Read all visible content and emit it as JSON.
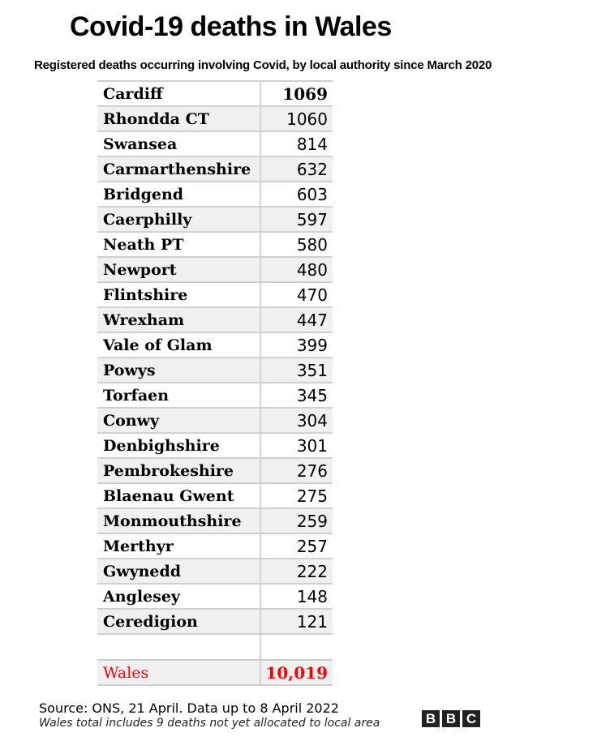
{
  "header": {
    "title": "Covid-19 deaths in Wales",
    "subtitle": "Registered deaths occurring involving Covid, by local authority since March 2020"
  },
  "chart_data": {
    "type": "table",
    "title": "Covid-19 deaths in Wales",
    "subtitle": "Registered deaths occurring involving Covid, by local authority since March 2020",
    "rows": [
      {
        "name": "Cardiff",
        "value": "1069"
      },
      {
        "name": "Rhondda CT",
        "value": "1060"
      },
      {
        "name": "Swansea",
        "value": "814"
      },
      {
        "name": "Carmarthenshire",
        "value": "632"
      },
      {
        "name": "Bridgend",
        "value": "603"
      },
      {
        "name": "Caerphilly",
        "value": "597"
      },
      {
        "name": "Neath PT",
        "value": "580"
      },
      {
        "name": "Newport",
        "value": "480"
      },
      {
        "name": "Flintshire",
        "value": "470"
      },
      {
        "name": "Wrexham",
        "value": "447"
      },
      {
        "name": "Vale of Glam",
        "value": "399"
      },
      {
        "name": "Powys",
        "value": "351"
      },
      {
        "name": "Torfaen",
        "value": "345"
      },
      {
        "name": "Conwy",
        "value": "304"
      },
      {
        "name": "Denbighshire",
        "value": "301"
      },
      {
        "name": "Pembrokeshire",
        "value": "276"
      },
      {
        "name": "Blaenau Gwent",
        "value": "275"
      },
      {
        "name": "Monmouthshire",
        "value": "259"
      },
      {
        "name": "Merthyr",
        "value": "257"
      },
      {
        "name": "Gwynedd",
        "value": "222"
      },
      {
        "name": "Anglesey",
        "value": "148"
      },
      {
        "name": "Ceredigion",
        "value": "121"
      }
    ],
    "total": {
      "name": "Wales",
      "value": "10,019"
    },
    "colors": {
      "total_text": "#ff0000",
      "alt_row_bg": "#f0f0f0",
      "border": "#d0d0d0"
    }
  },
  "footer": {
    "source": "Source: ONS, 21 April. Data up to 8 April 2022",
    "note": "Wales total includes 9 deaths not yet allocated to local area",
    "logo_letters": [
      "B",
      "B",
      "C"
    ]
  }
}
